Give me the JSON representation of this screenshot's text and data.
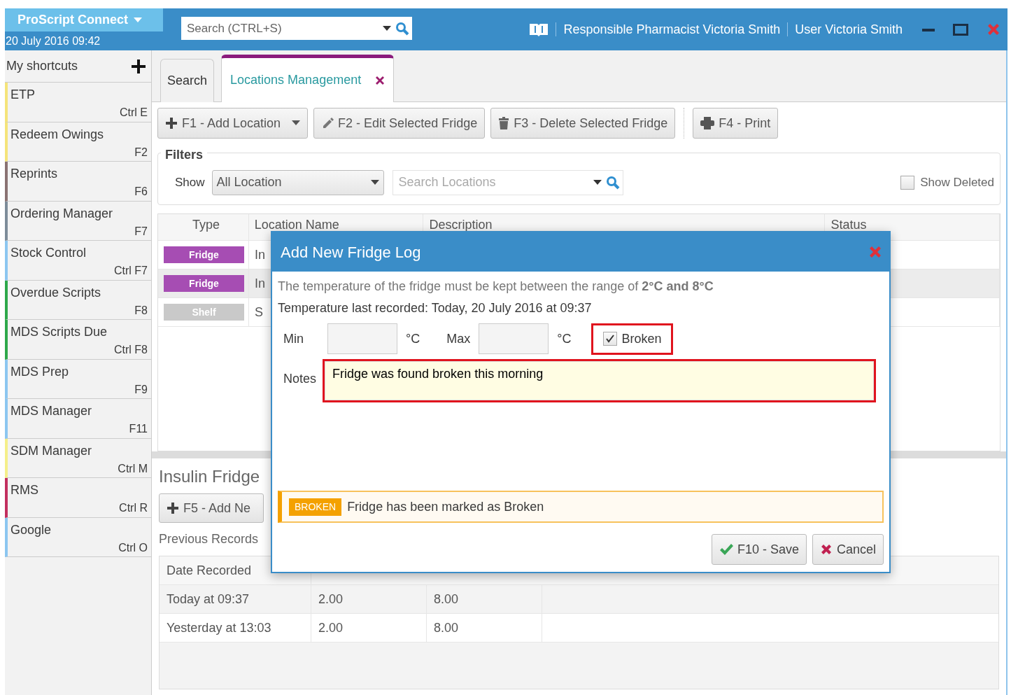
{
  "app": {
    "title": "ProScript Connect",
    "datetime": "20 July 2016 09:42"
  },
  "global_search": {
    "placeholder": "Search (CTRL+S)"
  },
  "header_info": [
    "Responsible Pharmacist Victoria Smith",
    "User Victoria Smith"
  ],
  "sidebar": {
    "title": "My shortcuts",
    "items": [
      {
        "label": "ETP",
        "shortcut": "Ctrl E",
        "color": "#f5e47a"
      },
      {
        "label": "Redeem Owings",
        "shortcut": "F2",
        "color": "#f5e47a"
      },
      {
        "label": "Reprints",
        "shortcut": "F6",
        "color": "#8a7272"
      },
      {
        "label": "Ordering Manager",
        "shortcut": "F7",
        "color": "#7d8c99"
      },
      {
        "label": "Stock Control",
        "shortcut": "Ctrl F7",
        "color": "#8cc6f0"
      },
      {
        "label": "Overdue Scripts",
        "shortcut": "F8",
        "color": "#2ea84a"
      },
      {
        "label": "MDS Scripts Due",
        "shortcut": "Ctrl F8",
        "color": "#2ea84a"
      },
      {
        "label": "MDS Prep",
        "shortcut": "F9",
        "color": "#8cc6f0"
      },
      {
        "label": "MDS Manager",
        "shortcut": "F11",
        "color": "#8cc6f0"
      },
      {
        "label": "SDM Manager",
        "shortcut": "Ctrl M",
        "color": "#f5ef8a"
      },
      {
        "label": "RMS",
        "shortcut": "Ctrl R",
        "color": "#c2305f"
      },
      {
        "label": "Google",
        "shortcut": "Ctrl O",
        "color": "#8cc6f0"
      }
    ]
  },
  "tabs": [
    {
      "label": "Search",
      "selected": false,
      "closable": false
    },
    {
      "label": "Locations Management",
      "selected": true,
      "closable": true
    }
  ],
  "toolbar": [
    [
      {
        "label": "F1 - Add Location",
        "kind": "add",
        "dropdown": true
      },
      {
        "label": "F2 - Edit Selected Fridge",
        "kind": "edit",
        "dropdown": false
      },
      {
        "label": "F3 - Delete Selected Fridge",
        "kind": "delete",
        "dropdown": false
      }
    ],
    [
      {
        "label": "F4 - Print",
        "kind": "print",
        "dropdown": false
      }
    ]
  ],
  "filters": {
    "title": "Filters",
    "show_label": "Show",
    "show_value": "All Location",
    "search_placeholder": "Search Locations",
    "show_deleted": {
      "label": "Show Deleted",
      "checked": false
    }
  },
  "locations_table": {
    "columns": [
      "Type",
      "Location Name",
      "Description",
      "Status"
    ],
    "rows": [
      {
        "type": "Fridge",
        "color": "#a64db3",
        "name": "In",
        "selected": false
      },
      {
        "type": "Fridge",
        "color": "#a64db3",
        "name": "In",
        "selected": true
      },
      {
        "type": "Shelf",
        "color": "#c9c9c9",
        "name": "S",
        "selected": false
      }
    ]
  },
  "detail": {
    "title": "Insulin Fridge",
    "add_button": "F5 - Add Ne",
    "previous_label": "Previous Records",
    "table": {
      "columns": [
        "Date Recorded"
      ],
      "rows": [
        [
          "Today at 09:37",
          "2.00",
          "8.00"
        ],
        [
          "Yesterday at 13:03",
          "2.00",
          "8.00"
        ]
      ]
    }
  },
  "dialog": {
    "title": "Add New Fridge Log",
    "info": "The temperature of the fridge must be kept between the range of **2°C and 8°C**",
    "last_recorded": "Temperature last recorded: Today, 20 July 2016 at 09:37",
    "min_label": "Min",
    "min_unit": "°C",
    "max_label": "Max",
    "max_unit": "°C",
    "broken": {
      "label": "Broken",
      "checked": true,
      "highlighted": true
    },
    "notes": {
      "label": "Notes",
      "value": "Fridge was found broken this morning",
      "highlighted": true
    },
    "alert": {
      "badge": "BROKEN",
      "message": "Fridge has been marked as Broken"
    },
    "buttons": [
      {
        "label": "F10 - Save",
        "kind": "save"
      },
      {
        "label": "Cancel",
        "kind": "cancel"
      }
    ]
  }
}
